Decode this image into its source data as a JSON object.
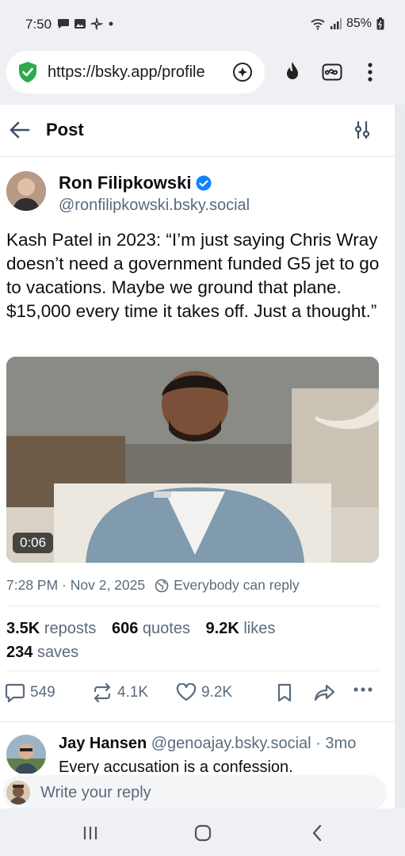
{
  "status_bar": {
    "time": "7:50",
    "battery": "85%",
    "icons": [
      "chat-notification-icon",
      "gallery-notification-icon",
      "pinwheel-notification-icon",
      "dot-icon",
      "wifi-icon",
      "signal-icon",
      "battery-icon"
    ]
  },
  "browser": {
    "url": "https://bsky.app/profile",
    "icons": [
      "shield-check-icon",
      "assistant-icon",
      "fire-icon",
      "infinity-icon",
      "more-vert-icon"
    ]
  },
  "header": {
    "title": "Post"
  },
  "post": {
    "author_name": "Ron Filipkowski",
    "author_handle": "@ronfilipkowski.bsky.social",
    "text": "Kash Patel in 2023: “I’m just saying Chris Wray doesn’t need a government funded G5 jet to go to vacations. Maybe we ground that plane. $15,000 every time it takes off. Just a thought.”",
    "video_duration": "0:06",
    "timestamp": "7:28 PM · Nov 2, 2025",
    "reply_setting": "Everybody can reply",
    "stats": {
      "reposts_count": "3.5K",
      "reposts_label": "reposts",
      "quotes_count": "606",
      "quotes_label": "quotes",
      "likes_count": "9.2K",
      "likes_label": "likes",
      "saves_count": "234",
      "saves_label": "saves"
    },
    "actions": {
      "replies": "549",
      "reposts": "4.1K",
      "likes": "9.2K"
    }
  },
  "reply": {
    "author_name": "Jay Hansen",
    "author_handle": "@genoajay.bsky.social",
    "age": "· 3mo",
    "text": "Every accusation is a confession."
  },
  "compose": {
    "placeholder": "Write your reply"
  },
  "colors": {
    "accent": "#1083fe",
    "muted": "#5a6b7c",
    "text": "#0b0f14",
    "shield_green": "#2fa84f"
  }
}
